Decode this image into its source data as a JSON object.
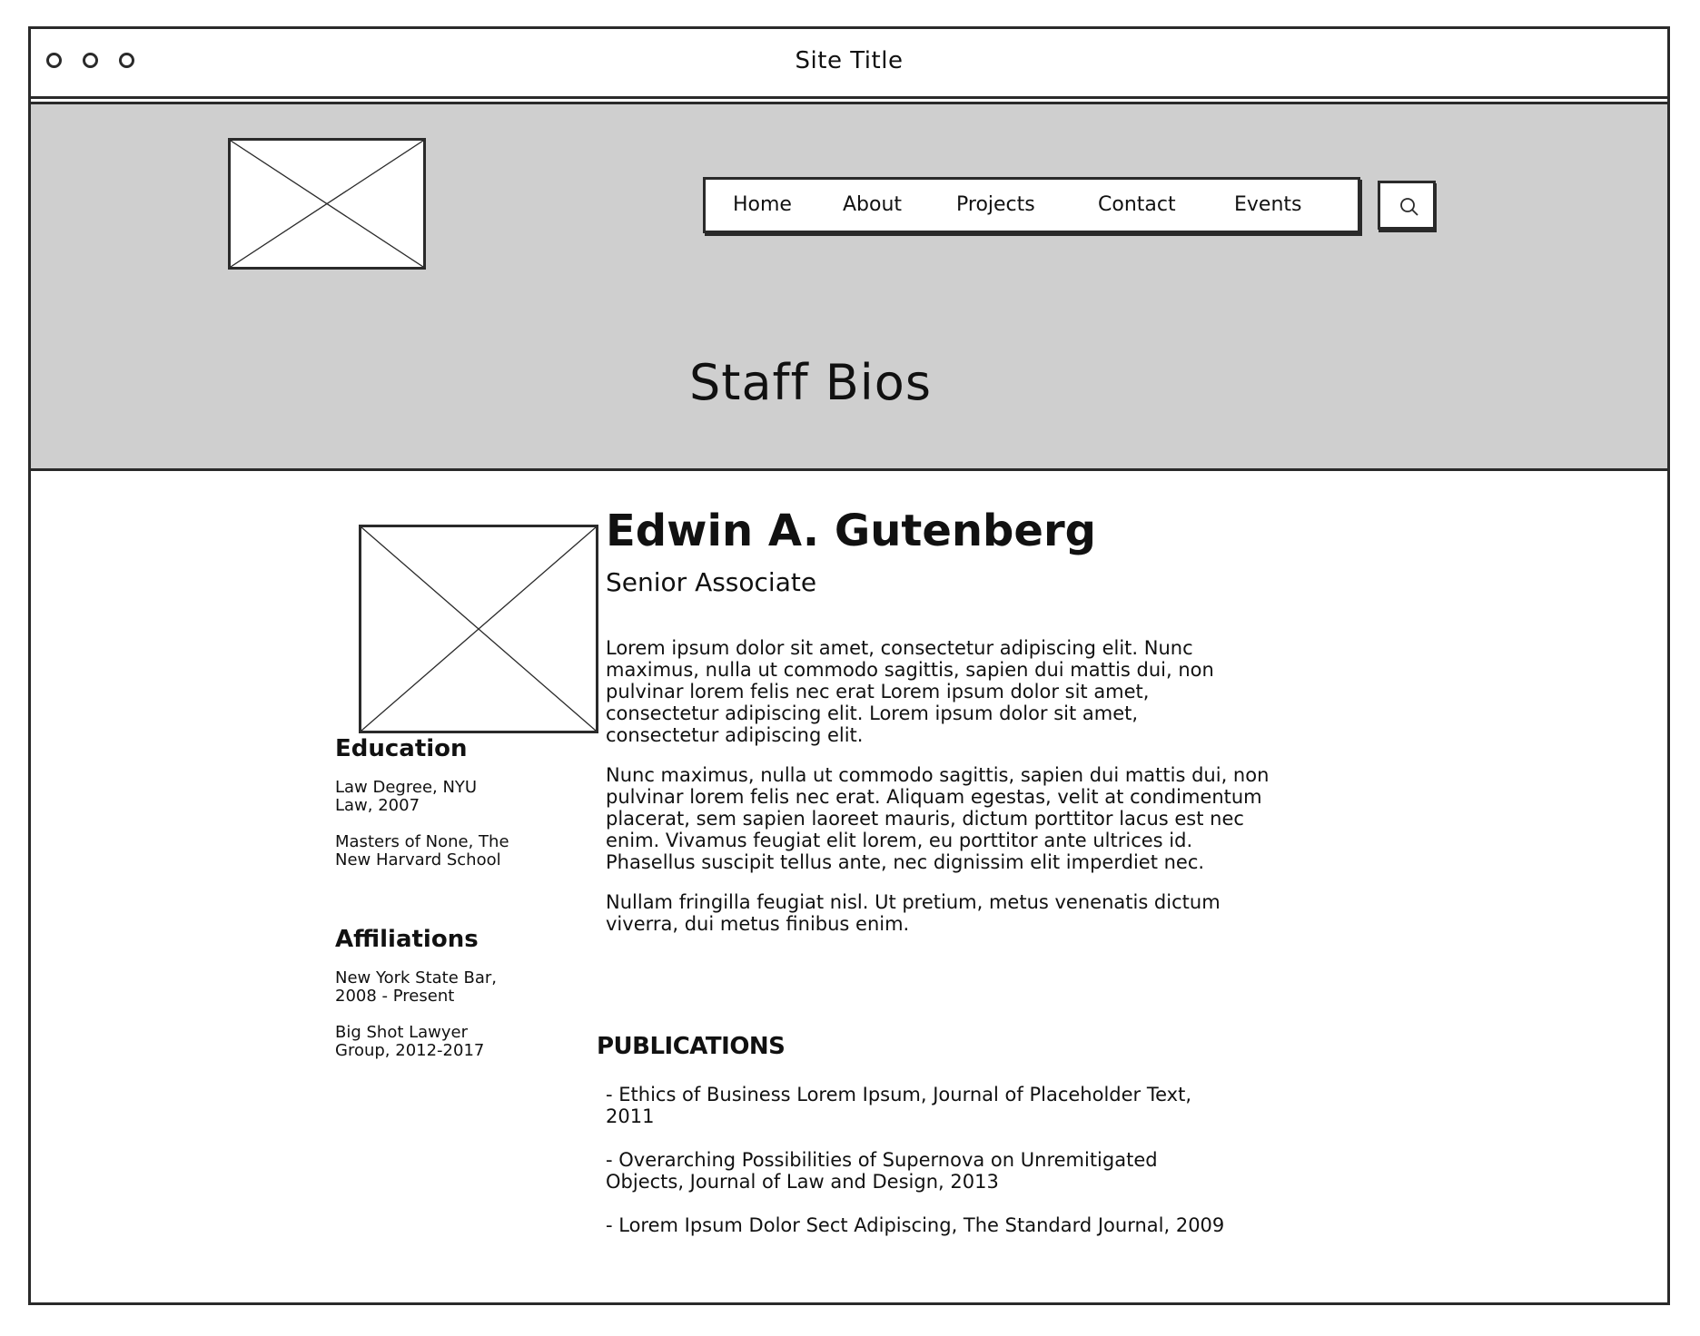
{
  "window": {
    "title": "Site Title",
    "controls": [
      "window-dot-1",
      "window-dot-2",
      "window-dot-3"
    ]
  },
  "header": {
    "logo": "image-placeholder",
    "nav": [
      {
        "label": "Home"
      },
      {
        "label": "About"
      },
      {
        "label": "Projects"
      },
      {
        "label": "Contact"
      },
      {
        "label": "Events"
      }
    ],
    "search_icon": "search-icon",
    "page_title": "Staff Bios"
  },
  "profile": {
    "photo": "image-placeholder",
    "name": "Edwin A. Gutenberg",
    "role": "Senior Associate",
    "bio": [
      "Lorem ipsum dolor sit amet, consectetur adipiscing elit. Nunc maximus, nulla ut commodo sagittis, sapien dui mattis dui, non pulvinar lorem felis nec erat Lorem ipsum dolor sit amet, consectetur adipiscing elit. Lorem ipsum dolor sit amet, consectetur adipiscing elit.",
      "Nunc maximus, nulla ut commodo sagittis, sapien dui mattis dui, non pulvinar lorem felis nec erat. Aliquam egestas, velit at condimentum placerat, sem sapien laoreet mauris, dictum porttitor lacus est nec enim. Vivamus feugiat elit lorem, eu porttitor ante ultrices id. Phasellus suscipit tellus ante, nec dignissim elit imperdiet nec.",
      "Nullam fringilla feugiat nisl. Ut pretium, metus venenatis dictum viverra, dui metus finibus enim."
    ]
  },
  "sidebar": {
    "education": {
      "heading": "Education",
      "items": [
        "Law Degree, NYU Law, 2007",
        "Masters of None, The New Harvard School"
      ]
    },
    "affiliations": {
      "heading": "Affiliations",
      "items": [
        "New York State Bar, 2008 - Present",
        "Big Shot Lawyer Group, 2012-2017"
      ]
    }
  },
  "publications": {
    "heading": "PUBLICATIONS",
    "items": [
      "- Ethics of Business Lorem Ipsum, Journal of Placeholder Text, 2011",
      "- Overarching Possibilities of Supernova on Unremitigated Objects, Journal of Law and Design, 2013",
      "- Lorem Ipsum Dolor Sect Adipiscing, The Standard Journal, 2009"
    ]
  }
}
